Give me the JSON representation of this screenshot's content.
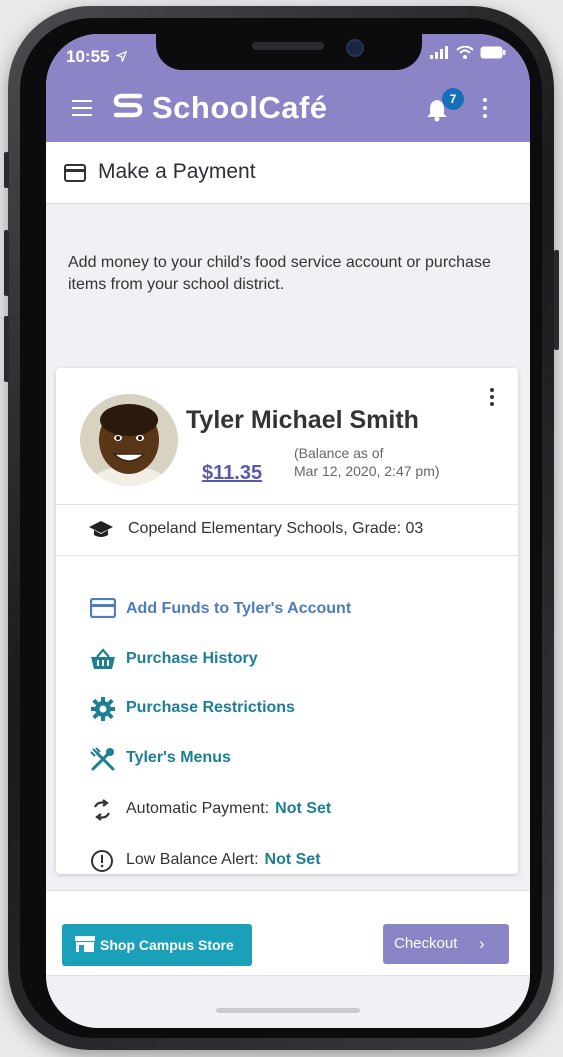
{
  "status_bar": {
    "time": "10:55",
    "icons": "signal wifi battery"
  },
  "header": {
    "logo_text": "SchoolCafé",
    "notification_count": "7",
    "brand_color": "#8b85c8"
  },
  "page": {
    "title": "Make a Payment",
    "intro": "Add money to your child's food service account or purchase items from your school district."
  },
  "student": {
    "name": "Tyler Michael Smith",
    "balance": "$11.35",
    "balance_note_line1": "(Balance as of",
    "balance_note_line2": "Mar 12, 2020, 2:47 pm)",
    "school": "Copeland Elementary Schools, Grade: 03"
  },
  "actions": [
    {
      "label": "Add Funds to Tyler's Account",
      "icon": "credit-card-icon"
    },
    {
      "label": "Purchase History",
      "icon": "basket-icon"
    },
    {
      "label": "Purchase Restrictions",
      "icon": "gear-icon"
    },
    {
      "label": "Tyler's Menus",
      "icon": "utensils-icon"
    }
  ],
  "settings": [
    {
      "label": "Automatic Payment:",
      "value": "Not Set",
      "icon": "sync-icon"
    },
    {
      "label": "Low Balance Alert:",
      "value": "Not Set",
      "icon": "alert-circle-icon"
    }
  ],
  "footer": {
    "shop_label": "Shop Campus Store",
    "checkout_label": "Checkout"
  }
}
